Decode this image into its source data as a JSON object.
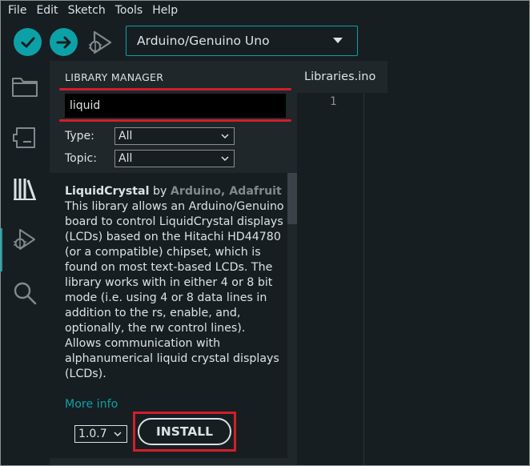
{
  "menubar": {
    "items": [
      "File",
      "Edit",
      "Sketch",
      "Tools",
      "Help"
    ]
  },
  "toolbar": {
    "verify_icon": "checkmark-icon",
    "upload_icon": "arrow-right-icon",
    "debug_icon": "debug-play-icon",
    "board": "Arduino/Genuino Uno"
  },
  "rail": {
    "icons": [
      "folder-icon",
      "board-icon",
      "library-icon",
      "debug-icon",
      "search-icon"
    ],
    "active": "library-icon"
  },
  "library_manager": {
    "title": "LIBRARY MANAGER",
    "search_value": "liquid",
    "type_label": "Type:",
    "type_value": "All",
    "topic_label": "Topic:",
    "topic_value": "All",
    "library": {
      "name": "LiquidCrystal",
      "by": " by ",
      "authors": "Arduino, Adafruit",
      "description": "This library allows an Arduino/Genuino board to control LiquidCrystal displays (LCDs) based on the Hitachi HD44780 (or a compatible) chipset, which is found on most text-based LCDs. The library works with in either 4 or 8 bit mode (i.e. using 4 or 8 data lines in addition to the rs, enable, and, optionally, the rw control lines). Allows communication with alphanumerical liquid crystal displays (LCDs).",
      "more_info": "More info",
      "version": "1.0.7",
      "install_label": "INSTALL"
    }
  },
  "editor": {
    "tab": "Libraries.ino",
    "line_number": "1"
  },
  "colors": {
    "accent": "#0ca1a6",
    "highlight_red": "#d11f2a",
    "background": "#171e21",
    "panel": "#1f272a"
  }
}
